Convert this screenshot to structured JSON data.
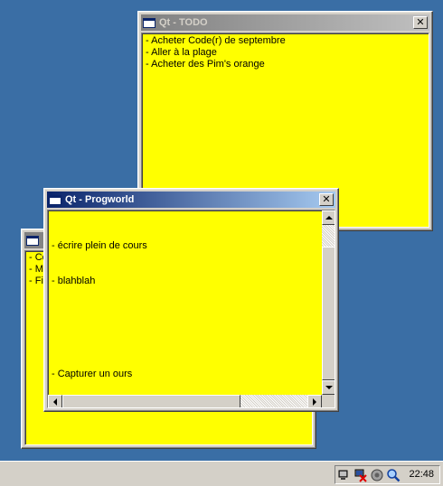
{
  "windows": {
    "todo": {
      "title": "Qt - TODO",
      "close": "✕",
      "lines": [
        "- Acheter Code(r) de septembre",
        "- Aller à la plage",
        "- Acheter des Pim's orange"
      ]
    },
    "back": {
      "lines": [
        "- Co",
        "- Ma",
        "- Fir"
      ]
    },
    "progworld": {
      "title": "Qt - Progworld",
      "close": "✕",
      "lines": [
        "- écrire plein de cours",
        "- blahblah",
        "- Capturer un ours"
      ]
    }
  },
  "taskbar": {
    "clock": "22:48",
    "tray_icons": [
      "network-icon",
      "network-disconnected-icon",
      "volume-icon",
      "search-icon"
    ]
  }
}
